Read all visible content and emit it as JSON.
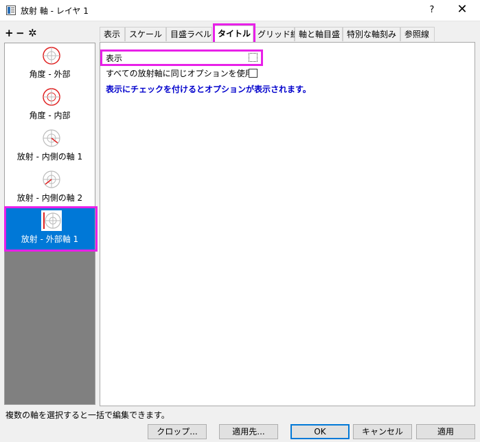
{
  "window": {
    "title": "放射 軸 - レイヤ 1",
    "help_label": "?",
    "close_label": "✕"
  },
  "toolbar": {
    "add_icon": "+",
    "remove_icon": "−",
    "settings_icon": "✲"
  },
  "axis_list": [
    {
      "label": "角度 - 外部",
      "icon": "angular-outer-axis-icon",
      "selected": false
    },
    {
      "label": "角度 - 内部",
      "icon": "angular-inner-axis-icon",
      "selected": false
    },
    {
      "label": "放射 - 内側の軸 1",
      "icon": "radial-inner-axis-icon",
      "selected": false
    },
    {
      "label": "放射 - 内側の軸 2",
      "icon": "radial-inner-axis-icon",
      "selected": false
    },
    {
      "label": "放射 - 外部軸 1",
      "icon": "radial-outer-axis-icon",
      "selected": true
    }
  ],
  "tabs": [
    {
      "label": "表示",
      "active": false
    },
    {
      "label": "スケール",
      "active": false
    },
    {
      "label": "目盛ラベル",
      "active": false
    },
    {
      "label": "タイトル",
      "active": true
    },
    {
      "label": "グリッド線",
      "active": false
    },
    {
      "label": "軸と軸目盛",
      "active": false
    },
    {
      "label": "特別な軸刻み",
      "active": false
    },
    {
      "label": "参照線",
      "active": false
    }
  ],
  "title_tab": {
    "show_label": "表示",
    "show_checked": false,
    "same_option_label": "すべての放射軸に同じオプションを使用",
    "same_option_checked": false,
    "hint": "表示にチェックを付けるとオプションが表示されます。"
  },
  "status_text": "複数の軸を選択すると一括で編集できます。",
  "buttons": {
    "crop": "クロップ...",
    "apply_to": "適用先...",
    "ok": "OK",
    "cancel": "キャンセル",
    "apply": "適用"
  },
  "colors": {
    "highlight": "#e820e8",
    "selection": "#0078d7",
    "hint_text": "#0000cc",
    "axis_red": "#e02020"
  }
}
